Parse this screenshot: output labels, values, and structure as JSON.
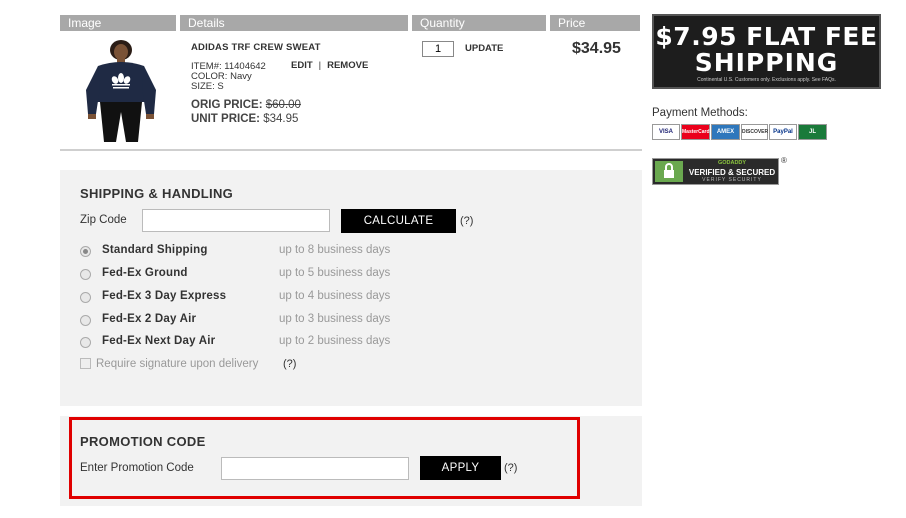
{
  "table_header": {
    "image": "Image",
    "details": "Details",
    "quantity": "Quantity",
    "price": "Price"
  },
  "product": {
    "name": "ADIDAS TRF CREW SWEAT",
    "item_label": "ITEM#:",
    "item_number": "11404642",
    "edit": "EDIT",
    "separator": "|",
    "remove": "REMOVE",
    "color_label": "COLOR:",
    "color": "Navy",
    "size_label": "SIZE:",
    "size": "S",
    "orig_price_label": "ORIG PRICE:",
    "orig_price": "$60.00",
    "unit_price_label": "UNIT PRICE:",
    "unit_price": "$34.95",
    "quantity": "1",
    "update": "UPDATE",
    "price": "$34.95"
  },
  "shipping": {
    "title": "SHIPPING & HANDLING",
    "zip_label": "Zip Code",
    "zip_value": "",
    "calculate": "CALCULATE",
    "help": "(?)",
    "options": [
      {
        "label": "Standard Shipping",
        "time": "up to 8 business days",
        "selected": true
      },
      {
        "label": "Fed-Ex Ground",
        "time": "up to 5 business days",
        "selected": false
      },
      {
        "label": "Fed-Ex 3 Day Express",
        "time": "up to 4 business days",
        "selected": false
      },
      {
        "label": "Fed-Ex 2 Day Air",
        "time": "up to 3 business days",
        "selected": false
      },
      {
        "label": "Fed-Ex Next Day Air",
        "time": "up to 2 business days",
        "selected": false
      }
    ],
    "signature_label": "Require signature upon delivery",
    "signature_help": "(?)"
  },
  "promo": {
    "title": "PROMOTION CODE",
    "label": "Enter Promotion Code",
    "value": "",
    "apply": "APPLY",
    "help": "(?)"
  },
  "banner": {
    "line1": "$7.95 FLAT FEE",
    "line2": "SHIPPING",
    "fine_print": "Continental U.S. Customers only. Exclusions apply. See FAQs."
  },
  "payment": {
    "label": "Payment Methods:",
    "cards": [
      "VISA",
      "MasterCard",
      "AMEX",
      "DISCOVER",
      "PayPal",
      "JL"
    ]
  },
  "godaddy": {
    "brand": "GODADDY",
    "title": "VERIFIED & SECURED",
    "subtitle": "VERIFY SECURITY",
    "reg": "®"
  },
  "colors": {
    "accent_black": "#000000",
    "highlight_red": "#e00000",
    "header_gray": "#a8a8a8",
    "panel_bg": "#f2f2f2"
  }
}
